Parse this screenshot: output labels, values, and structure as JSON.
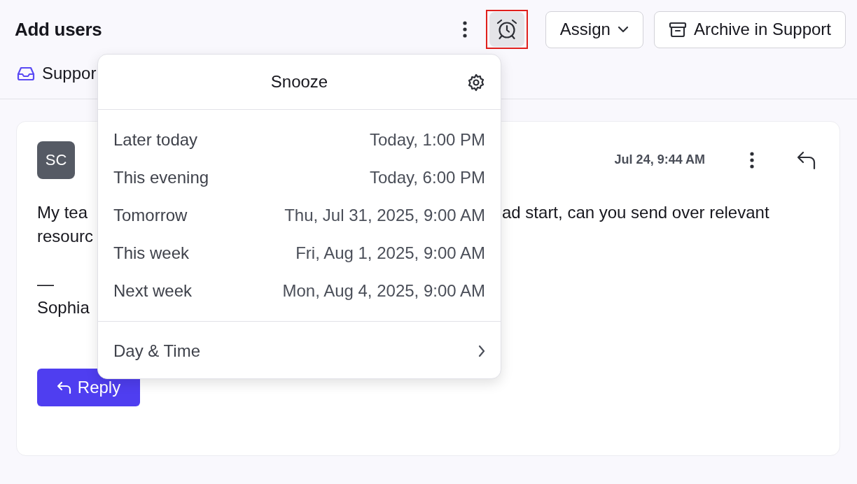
{
  "header": {
    "title": "Add users",
    "snooze_button": {
      "active": true,
      "highlighted": true
    },
    "buttons": [
      {
        "kind": "dropdown",
        "label": "Assign"
      },
      {
        "kind": "archive",
        "label": "Archive in Support"
      }
    ]
  },
  "inbox_tag": {
    "label": "Suppor"
  },
  "message": {
    "avatar": "SC",
    "time": "Jul 24, 9:44 AM",
    "body_lines": [
      {
        "left": "My tea",
        "right": "ad start, can you send over relevant"
      },
      {
        "left": "resourc"
      },
      {
        "left": "—",
        "new_paragraph": true
      },
      {
        "left": "Sophia"
      }
    ],
    "reply_button": "Reply"
  },
  "snooze_menu": {
    "title": "Snooze",
    "options": [
      {
        "label": "Later today",
        "time": "Today, 1:00 PM"
      },
      {
        "label": "This evening",
        "time": "Today, 6:00 PM"
      },
      {
        "label": "Tomorrow",
        "time": "Thu, Jul 31, 2025, 9:00 AM"
      },
      {
        "label": "This week",
        "time": "Fri, Aug 1, 2025, 9:00 AM"
      },
      {
        "label": "Next week",
        "time": "Mon, Aug 4, 2025, 9:00 AM"
      }
    ],
    "custom": "Day & Time"
  }
}
